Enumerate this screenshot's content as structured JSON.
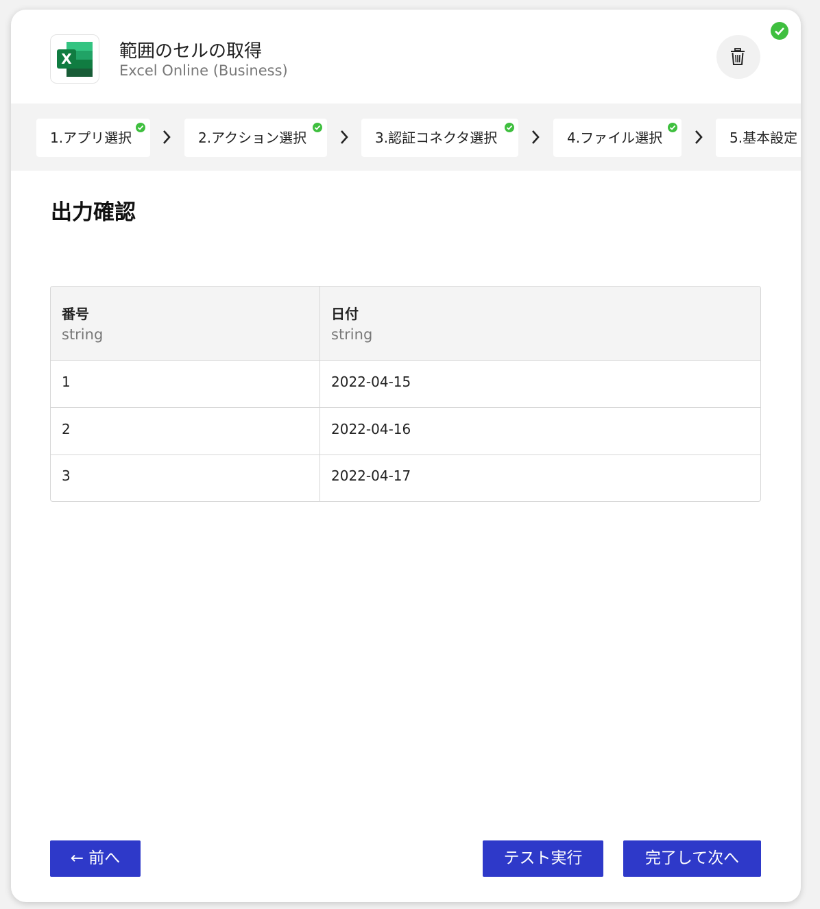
{
  "header": {
    "title": "範囲のセルの取得",
    "subtitle": "Excel Online (Business)",
    "app_icon": "excel-icon",
    "delete_icon": "trash-icon",
    "status_icon": "check-circle-icon",
    "status_color": "#3fbf3f"
  },
  "steps": [
    {
      "label": "1.アプリ選択",
      "done": true
    },
    {
      "label": "2.アクション選択",
      "done": true
    },
    {
      "label": "3.認証コネクタ選択",
      "done": true
    },
    {
      "label": "4.ファイル選択",
      "done": true
    },
    {
      "label": "5.基本設定",
      "done": false
    }
  ],
  "section": {
    "title": "出力確認"
  },
  "table": {
    "columns": [
      {
        "name": "番号",
        "type": "string"
      },
      {
        "name": "日付",
        "type": "string"
      }
    ],
    "rows": [
      [
        "1",
        "2022-04-15"
      ],
      [
        "2",
        "2022-04-16"
      ],
      [
        "3",
        "2022-04-17"
      ]
    ]
  },
  "footer": {
    "prev_label": "← 前へ",
    "test_label": "テスト実行",
    "next_label": "完了して次へ",
    "button_color": "#2e39c9"
  }
}
